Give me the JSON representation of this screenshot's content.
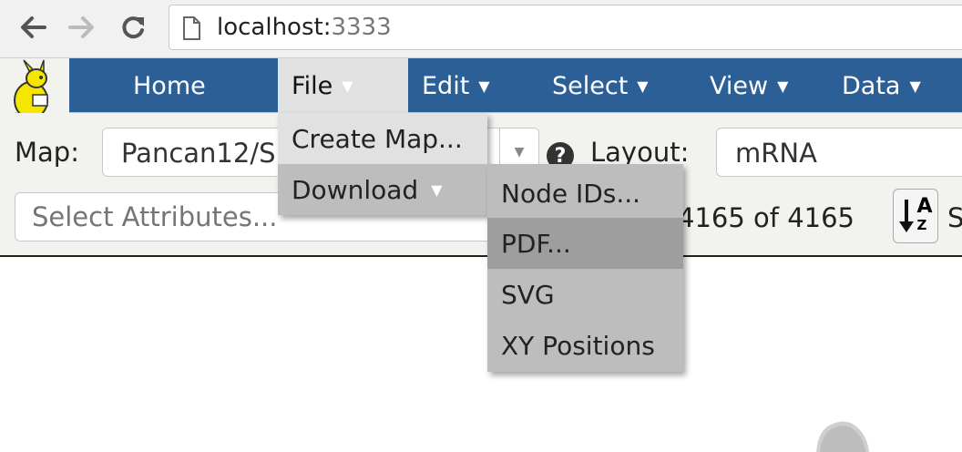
{
  "browser": {
    "url_host": "localhost:",
    "url_port": "3333",
    "icons": [
      "back-arrow-icon",
      "forward-arrow-icon",
      "reload-icon",
      "page-icon"
    ]
  },
  "nav": {
    "logo": "kangaroo-logo",
    "items": [
      {
        "label": "Home",
        "caret": ""
      },
      {
        "label": "File",
        "caret": "▼"
      },
      {
        "label": "Edit",
        "caret": "▼"
      },
      {
        "label": "Select",
        "caret": "▼"
      },
      {
        "label": "View",
        "caret": "▼"
      },
      {
        "label": "Data",
        "caret": "▼"
      }
    ],
    "active_item": "File",
    "bar_color": "#2c5f96"
  },
  "toolbar": {
    "map_label": "Map:",
    "map_value": "Pancan12/S",
    "help_icon": "?",
    "layout_label": "Layout:",
    "layout_value": "mRNA",
    "attr_placeholder": "Select Attributes...",
    "count_text": "4165 of 4165",
    "sort_icon_top": "A",
    "sort_icon_bottom": "Z",
    "edge_text": "S"
  },
  "file_menu": {
    "items": [
      {
        "label": "Create Map...",
        "caret": ""
      },
      {
        "label": "Download",
        "caret": "▼"
      }
    ],
    "highlighted": "Download"
  },
  "download_submenu": {
    "items": [
      "Node IDs...",
      "PDF...",
      "SVG",
      "XY Positions"
    ],
    "highlighted": "PDF..."
  }
}
